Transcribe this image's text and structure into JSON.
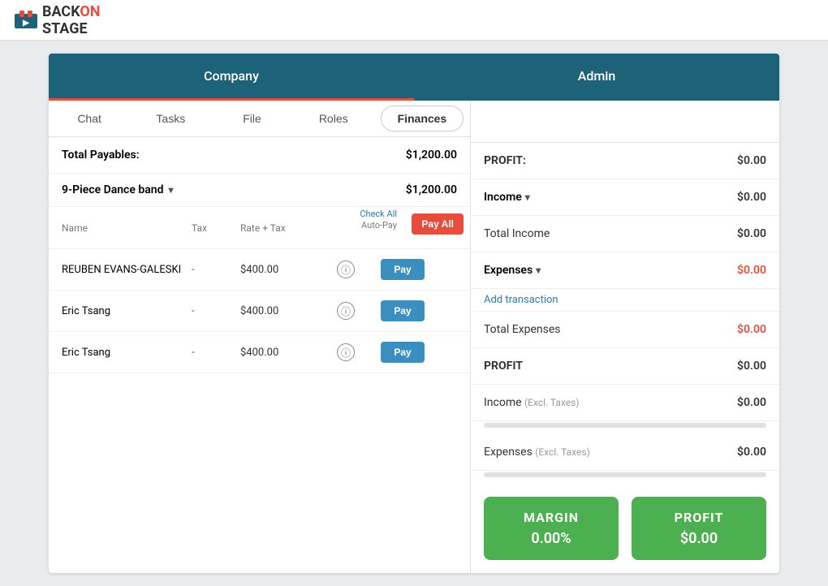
{
  "logo": {
    "back": "BACK",
    "on": "ON",
    "stage": "STAGE"
  },
  "header_tabs": [
    {
      "id": "company",
      "label": "Company",
      "active": true
    },
    {
      "id": "admin",
      "label": "Admin",
      "active": false
    }
  ],
  "sub_tabs": [
    {
      "id": "chat",
      "label": "Chat"
    },
    {
      "id": "tasks",
      "label": "Tasks"
    },
    {
      "id": "file",
      "label": "File"
    },
    {
      "id": "roles",
      "label": "Roles"
    },
    {
      "id": "finances",
      "label": "Finances",
      "active": true
    }
  ],
  "left": {
    "total_payables_label": "Total Payables:",
    "total_payables_value": "$1,200.00",
    "band_name": "9-Piece Dance band",
    "band_amount": "$1,200.00",
    "table": {
      "col_name": "Name",
      "col_tax": "Tax",
      "col_rate_tax": "Rate + Tax",
      "check_all": "Check All",
      "auto_pay": "Auto-Pay",
      "pay_all_label": "Pay All"
    },
    "members": [
      {
        "name": "REUBEN EVANS-GALESKI",
        "tax": "-",
        "rate": "$400.00",
        "pay_label": "Pay"
      },
      {
        "name": "Eric Tsang",
        "tax": "-",
        "rate": "$400.00",
        "pay_label": "Pay"
      },
      {
        "name": "Eric Tsang",
        "tax": "-",
        "rate": "$400.00",
        "pay_label": "Pay"
      }
    ]
  },
  "right": {
    "profit_label": "PROFIT:",
    "profit_value": "$0.00",
    "income_label": "Income",
    "income_value": "$0.00",
    "total_income_label": "Total Income",
    "total_income_value": "$0.00",
    "expenses_label": "Expenses",
    "expenses_value": "$0.00",
    "add_transaction_label": "Add transaction",
    "total_expenses_label": "Total Expenses",
    "total_expenses_value": "$0.00",
    "profit2_label": "PROFIT",
    "profit2_value": "$0.00",
    "income_excl_label": "Income",
    "income_excl_sublabel": "(Excl. Taxes)",
    "income_excl_value": "$0.00",
    "expenses_excl_label": "Expenses",
    "expenses_excl_sublabel": "(Excl. Taxes)",
    "expenses_excl_value": "$0.00",
    "margin_card": {
      "title": "MARGIN",
      "value": "0.00%"
    },
    "profit_card": {
      "title": "PROFIT",
      "value": "$0.00"
    }
  }
}
